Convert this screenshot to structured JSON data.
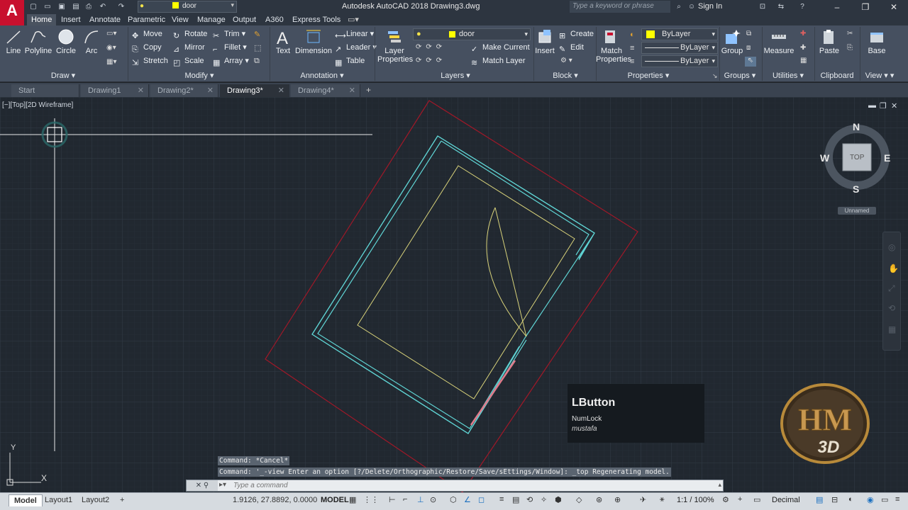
{
  "app": {
    "logo_letter": "A",
    "title": "Autodesk AutoCAD 2018   Drawing3.dwg",
    "search_placeholder": "Type a keyword or phrase",
    "signin_label": "Sign In",
    "quick_layer": "door"
  },
  "ribbon_tabs": [
    "Home",
    "Insert",
    "Annotate",
    "Parametric",
    "View",
    "Manage",
    "Output",
    "A360",
    "Express Tools"
  ],
  "ribbon": {
    "draw": {
      "title": "Draw",
      "line": "Line",
      "polyline": "Polyline",
      "circle": "Circle",
      "arc": "Arc"
    },
    "modify": {
      "title": "Modify",
      "move": "Move",
      "rotate": "Rotate",
      "trim": "Trim",
      "copy": "Copy",
      "mirror": "Mirror",
      "fillet": "Fillet",
      "stretch": "Stretch",
      "scale": "Scale",
      "array": "Array"
    },
    "annotation": {
      "title": "Annotation",
      "text": "Text",
      "dimension": "Dimension",
      "linear": "Linear",
      "leader": "Leader",
      "table": "Table"
    },
    "layers": {
      "title": "Layers",
      "layer_properties": "Layer Properties",
      "current_layer": "door",
      "make_current": "Make Current",
      "match_layer": "Match Layer"
    },
    "block": {
      "title": "Block",
      "insert": "Insert",
      "create": "Create",
      "edit": "Edit"
    },
    "properties": {
      "title": "Properties",
      "match_properties": "Match Properties",
      "color": "ByLayer",
      "linetype": "ByLayer",
      "lineweight": "ByLayer"
    },
    "groups": {
      "title": "Groups",
      "group": "Group"
    },
    "utilities": {
      "title": "Utilities",
      "measure": "Measure"
    },
    "clipboard": {
      "title": "Clipboard",
      "paste": "Paste"
    },
    "view": {
      "title": "View",
      "base": "Base"
    }
  },
  "doc_tabs": [
    {
      "label": "Start",
      "active": false
    },
    {
      "label": "Drawing1",
      "active": false
    },
    {
      "label": "Drawing2*",
      "active": false
    },
    {
      "label": "Drawing3*",
      "active": true
    },
    {
      "label": "Drawing4*",
      "active": false
    }
  ],
  "viewport": {
    "label": "[−][Top][2D Wireframe]",
    "viewcube": {
      "n": "N",
      "s": "S",
      "e": "E",
      "w": "W",
      "face": "TOP",
      "ucs": "Unnamed"
    },
    "axis_y": "Y",
    "axis_x": "X"
  },
  "key_overlay": {
    "key": "LButton",
    "mod": "NumLock",
    "user": "mustafa"
  },
  "command": {
    "history": [
      "Command: *Cancel*",
      "Command: '_-view Enter an option [?/Delete/Orthographic/Restore/Save/sEttings/Window]: _top Regenerating model."
    ],
    "placeholder": "Type a command"
  },
  "status": {
    "layout_tabs": [
      "Model",
      "Layout1",
      "Layout2"
    ],
    "coords": "1.9126, 27.8892, 0.0000",
    "space": "MODEL",
    "scale": "1:1 / 100%",
    "units": "Decimal"
  },
  "watermark": {
    "text": "HM",
    "sub": "3D"
  },
  "colors": {
    "accent_red": "#c8102e",
    "outer_boundary": "#a01828",
    "walls": "#5fd3d3",
    "inner_room": "#d8d27a",
    "door_swing": "#d8d27a"
  }
}
